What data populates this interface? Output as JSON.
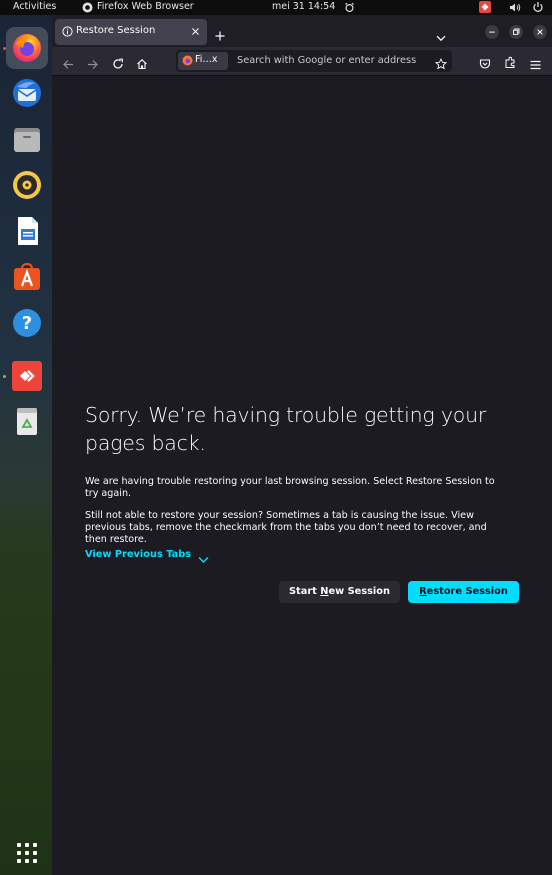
{
  "topbar": {
    "activities": "Activities",
    "app_name": "Firefox Web Browser",
    "clock": "mei 31  14:54"
  },
  "dock": {
    "apps": [
      {
        "name": "Firefox",
        "icon": "firefox-icon",
        "running": true
      },
      {
        "name": "Thunderbird",
        "icon": "thunderbird-icon"
      },
      {
        "name": "Files",
        "icon": "files-icon"
      },
      {
        "name": "Rhythmbox",
        "icon": "rhythmbox-icon"
      },
      {
        "name": "LibreOffice Writer",
        "icon": "writer-icon"
      },
      {
        "name": "Ubuntu Software",
        "icon": "software-store-icon"
      },
      {
        "name": "Help",
        "icon": "help-icon"
      },
      {
        "name": "AnyDesk",
        "icon": "anydesk-icon",
        "running": true
      },
      {
        "name": "Trash",
        "icon": "trash-icon"
      }
    ],
    "show_apps_icon": "app-grid-icon"
  },
  "browser": {
    "tab": {
      "title": "Restore Session"
    },
    "identity_label": "Fi…x",
    "urlbar_placeholder": "Search with Google or enter address"
  },
  "page": {
    "heading": "Sorry. We’re having trouble getting your pages back.",
    "para1": "We are having trouble restoring your last browsing session. Select Restore Session to try again.",
    "para2": "Still not able to restore your session? Sometimes a tab is causing the issue. View previous tabs, remove the checkmark from the tabs you don’t need to recover, and then restore.",
    "view_previous_tabs": "View Previous Tabs",
    "start_new": {
      "pre": "Start ",
      "key": "N",
      "post": "ew Session"
    },
    "restore": {
      "pre": "",
      "key": "R",
      "post": "estore Session"
    }
  },
  "colors": {
    "accent": "#00ddff",
    "page_bg": "#1c1b22",
    "toolbar_bg": "#2b2a33",
    "tab_bg": "#42414d"
  }
}
